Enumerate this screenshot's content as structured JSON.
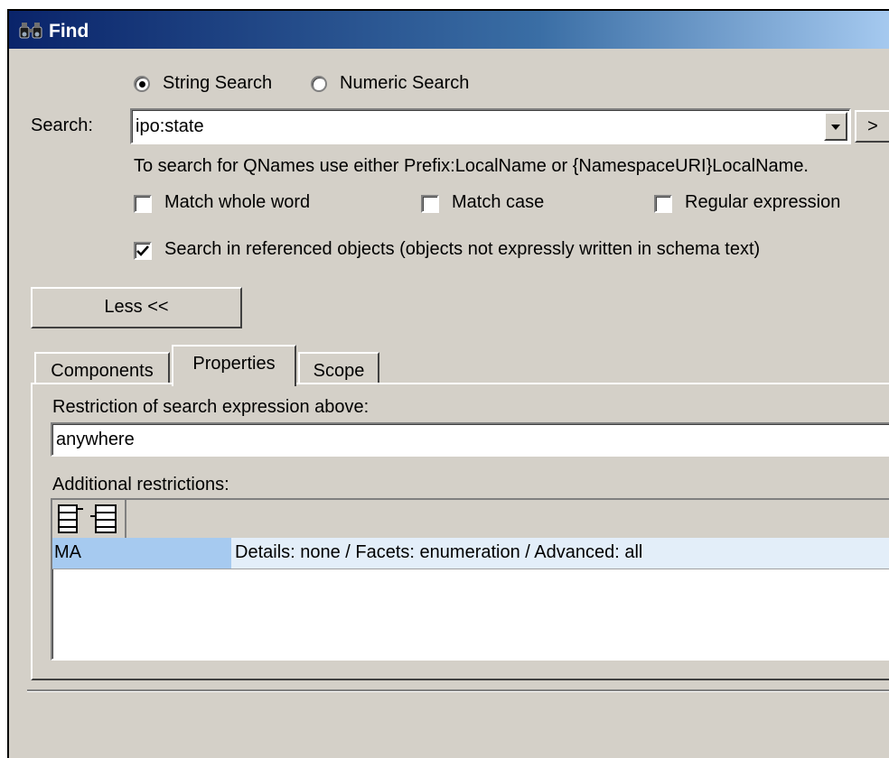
{
  "window": {
    "title": "Find"
  },
  "search_mode": {
    "string_label": "String Search",
    "numeric_label": "Numeric Search",
    "selected": "string"
  },
  "search": {
    "label": "Search:",
    "value": "ipo:state",
    "hint": "To search for QNames use either Prefix:LocalName or {NamespaceURI}LocalName.",
    "more_button": ">"
  },
  "options": {
    "match_whole_word": {
      "label": "Match whole word",
      "checked": false
    },
    "match_case": {
      "label": "Match case",
      "checked": false
    },
    "regular_expression": {
      "label": "Regular expression",
      "checked": false
    },
    "search_referenced": {
      "label": "Search in referenced objects (objects not expressly written in schema text)",
      "checked": true
    }
  },
  "less_button": "Less <<",
  "tabs": [
    {
      "label": "Components",
      "active": false
    },
    {
      "label": "Properties",
      "active": true
    },
    {
      "label": "Scope",
      "active": false
    }
  ],
  "properties": {
    "restriction_label": "Restriction of search expression above:",
    "restriction_value": "anywhere",
    "additional_label": "Additional restrictions:",
    "rows": [
      {
        "name": "MA",
        "details": "Details: none / Facets: enumeration / Advanced: all"
      }
    ],
    "colors": {
      "selected_name": "#a6caf0",
      "selected_row": "#e3eef9"
    }
  },
  "icons": [
    "binoculars-icon",
    "append-row-icon",
    "insert-row-icon",
    "dropdown-arrow-icon"
  ]
}
